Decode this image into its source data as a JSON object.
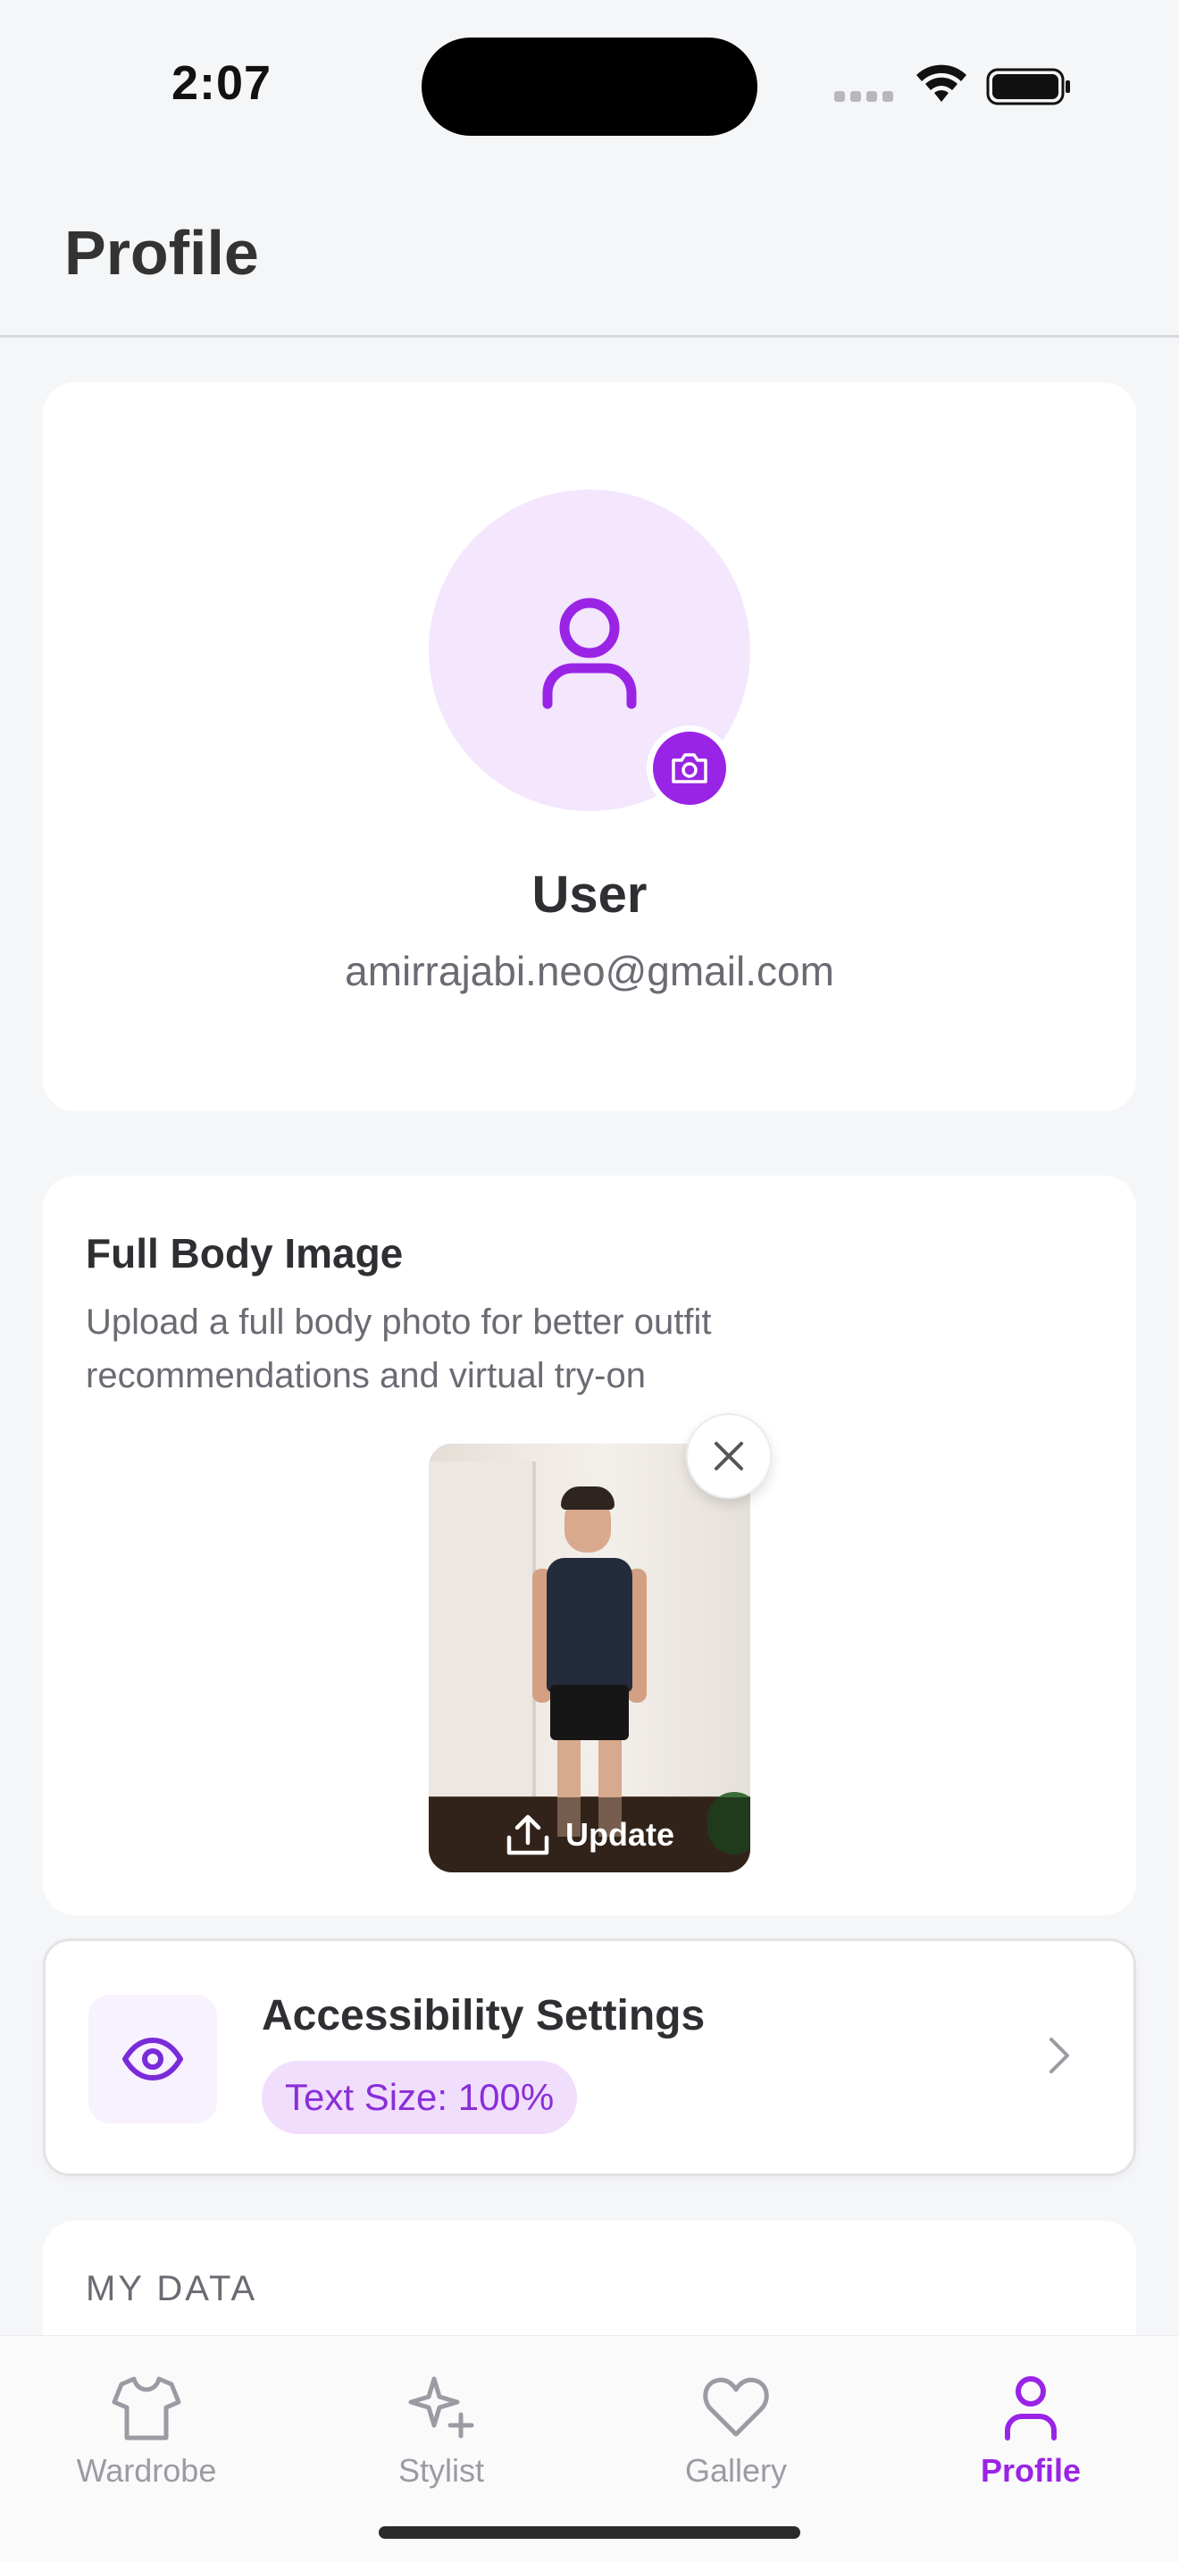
{
  "status_bar": {
    "time": "2:07"
  },
  "header": {
    "title": "Profile"
  },
  "profile": {
    "name": "User",
    "email": "amirrajabi.neo@gmail.com"
  },
  "full_body": {
    "title": "Full Body Image",
    "description": "Upload a full body photo for better outfit recommendations and virtual try-on",
    "update_label": "Update"
  },
  "accessibility": {
    "title": "Accessibility Settings",
    "badge": "Text Size: 100%"
  },
  "my_data": {
    "title": "MY DATA"
  },
  "tab_bar": {
    "tabs": [
      {
        "label": "Wardrobe",
        "icon": "shirt-icon",
        "active": false
      },
      {
        "label": "Stylist",
        "icon": "sparkles-icon",
        "active": false
      },
      {
        "label": "Gallery",
        "icon": "heart-icon",
        "active": false
      },
      {
        "label": "Profile",
        "icon": "user-icon",
        "active": true
      }
    ]
  },
  "colors": {
    "accent": "#9a24e6",
    "accent_light": "#f3e6fd",
    "background": "#f5f6f8",
    "muted_text": "#6b6b73"
  }
}
